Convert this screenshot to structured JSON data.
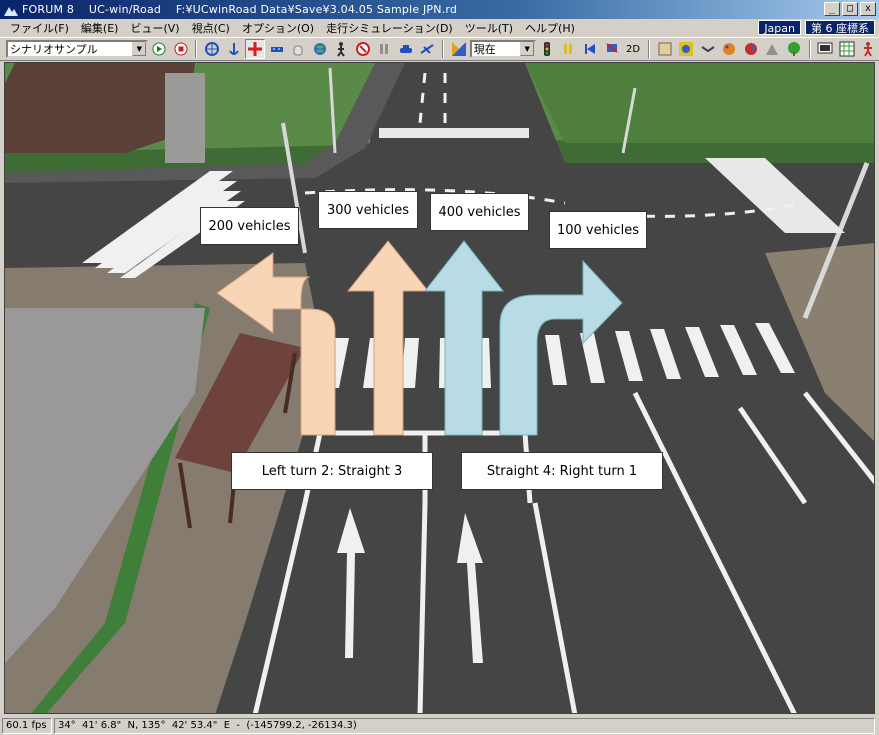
{
  "window": {
    "title": "FORUM 8    UC-win/Road    F:¥UCwinRoad Data¥Save¥3.04.05 Sample JPN.rd",
    "minimize": "_",
    "maximize": "□",
    "close": "x"
  },
  "menu": {
    "items": [
      "ファイル(F)",
      "編集(E)",
      "ビュー(V)",
      "視点(C)",
      "オプション(O)",
      "走行シミュレーション(D)",
      "ツール(T)",
      "ヘルプ(H)"
    ],
    "region": "Japan",
    "coordinate_system": "第 6 座標系"
  },
  "toolbar": {
    "scenario_select": "シナリオサンプル",
    "time_select": "現在",
    "mode_2d": "2D"
  },
  "icons": [
    "scenario-play-icon",
    "scenario-stop-icon",
    "move-icon",
    "anchor-icon",
    "cross-cursor-icon",
    "road-tool-icon",
    "hand-icon",
    "globe-icon",
    "pedestrian-icon",
    "no-entry-icon",
    "pause-icon",
    "car-icon",
    "airplane-icon",
    "camera-view-icon",
    "traffic-light-icon",
    "pause-sim-icon",
    "rewind-icon",
    "flag-icon",
    "layers-icon",
    "sign-icon",
    "shape-icon",
    "palette-icon",
    "paint-icon",
    "building-icon",
    "tree-icon",
    "monitor-icon",
    "grid-icon",
    "person-icon"
  ],
  "scene": {
    "labels": {
      "left_count": "200 vehicles",
      "straight3_count": "300 vehicles",
      "straight4_count": "400 vehicles",
      "right_count": "100 vehicles",
      "lane_left": "Left turn 2: Straight 3",
      "lane_right": "Straight 4: Right turn 1"
    },
    "colors": {
      "left_lane_arrow": "#f8d5b5",
      "right_lane_arrow": "#b8dce6",
      "road": "#454545",
      "grass": "#4a7a3a"
    }
  },
  "status": {
    "fps": "60.1 fps",
    "latlon": "34°  41' 6.8\"  N, 135°  42' 53.4\"  E  -  (-145799.2, -26134.3)"
  }
}
